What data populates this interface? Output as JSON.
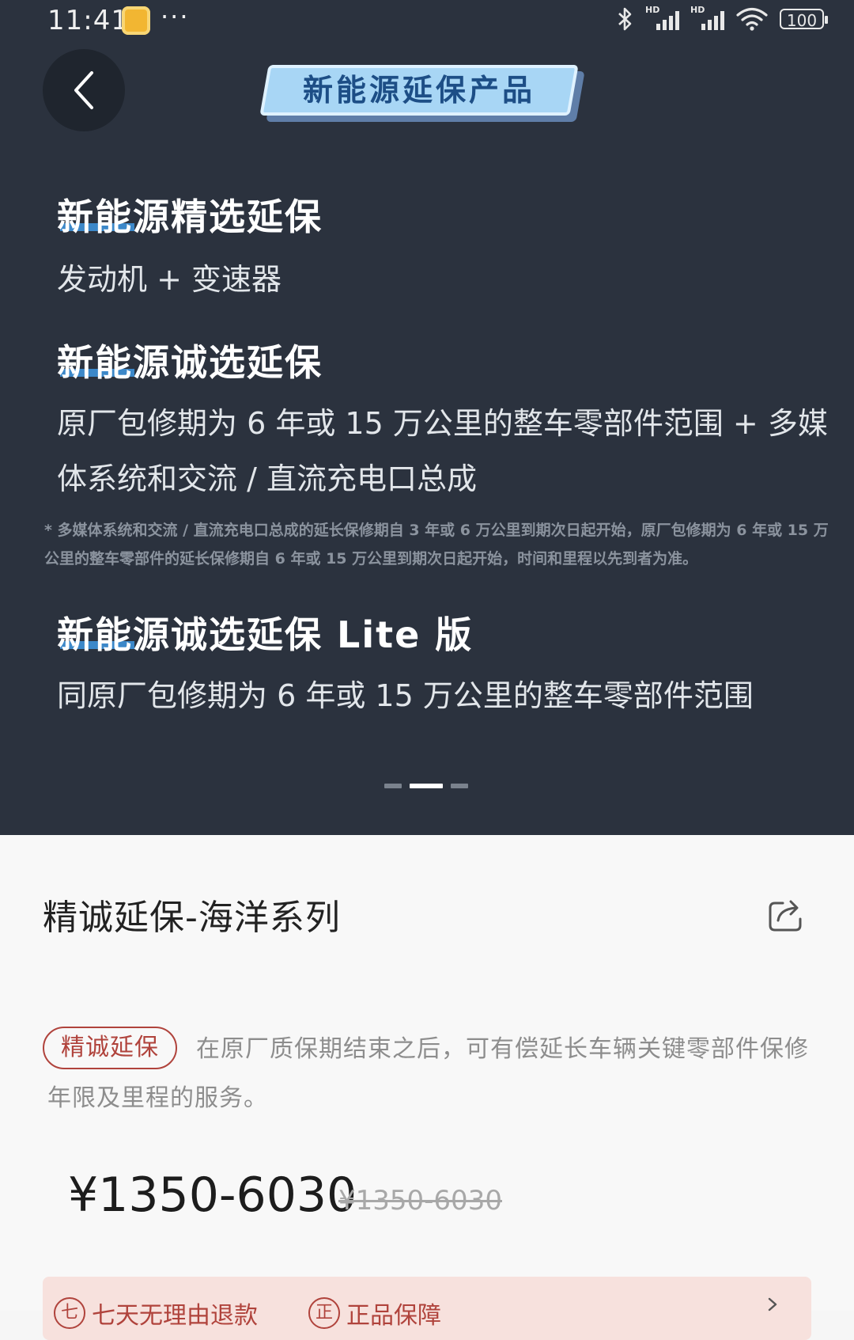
{
  "status_bar": {
    "time": "11:41",
    "dots": "···",
    "signal_hd_1": "HD",
    "signal_hd_2": "HD",
    "battery": "100"
  },
  "header": {
    "back_icon": "chevron-left-icon",
    "badge_title": "新能源延保产品"
  },
  "sections": [
    {
      "title": "新能源精选延保",
      "desc": "发动机 + 变速器"
    },
    {
      "title": "新能源诚选延保",
      "desc": "原厂包修期为 6 年或 15 万公里的整车零部件范围 + 多媒体系统和交流 / 直流充电口总成"
    },
    {
      "title": "新能源诚选延保 Lite 版",
      "desc": "同原厂包修期为 6 年或 15 万公里的整车零部件范围"
    }
  ],
  "footnote": "* 多媒体系统和交流 / 直流充电口总成的延长保修期自 3 年或 6 万公里到期次日起开始，原厂包修期为 6 年或 15 万公里的整车零部件的延长保修期自 6 年或 15 万公里到期次日起开始，时间和里程以先到者为准。",
  "pager": {
    "count": 3,
    "active_index": 1
  },
  "product": {
    "title": "精诚延保-海洋系列",
    "share_icon": "share-icon",
    "tag": "精诚延保",
    "description": "在原厂质保期结束之后，可有偿延长车辆关键零部件保修年限及里程的服务。",
    "price": "¥1350-6030",
    "original_price": "¥1350-6030",
    "promo": {
      "item1_icon": "七",
      "item1_label": "七天无理由退款",
      "item2_icon": "正",
      "item2_label": "正品保障",
      "chevron_icon": "chevron-right-icon"
    }
  },
  "colors": {
    "hero_bg": "#2b323e",
    "accent_blue": "#3c88c9",
    "badge_fill": "#a8d6f5",
    "badge_text": "#1d4e86",
    "brand_red": "#b0433c",
    "promo_bg": "#f7e1dd"
  }
}
